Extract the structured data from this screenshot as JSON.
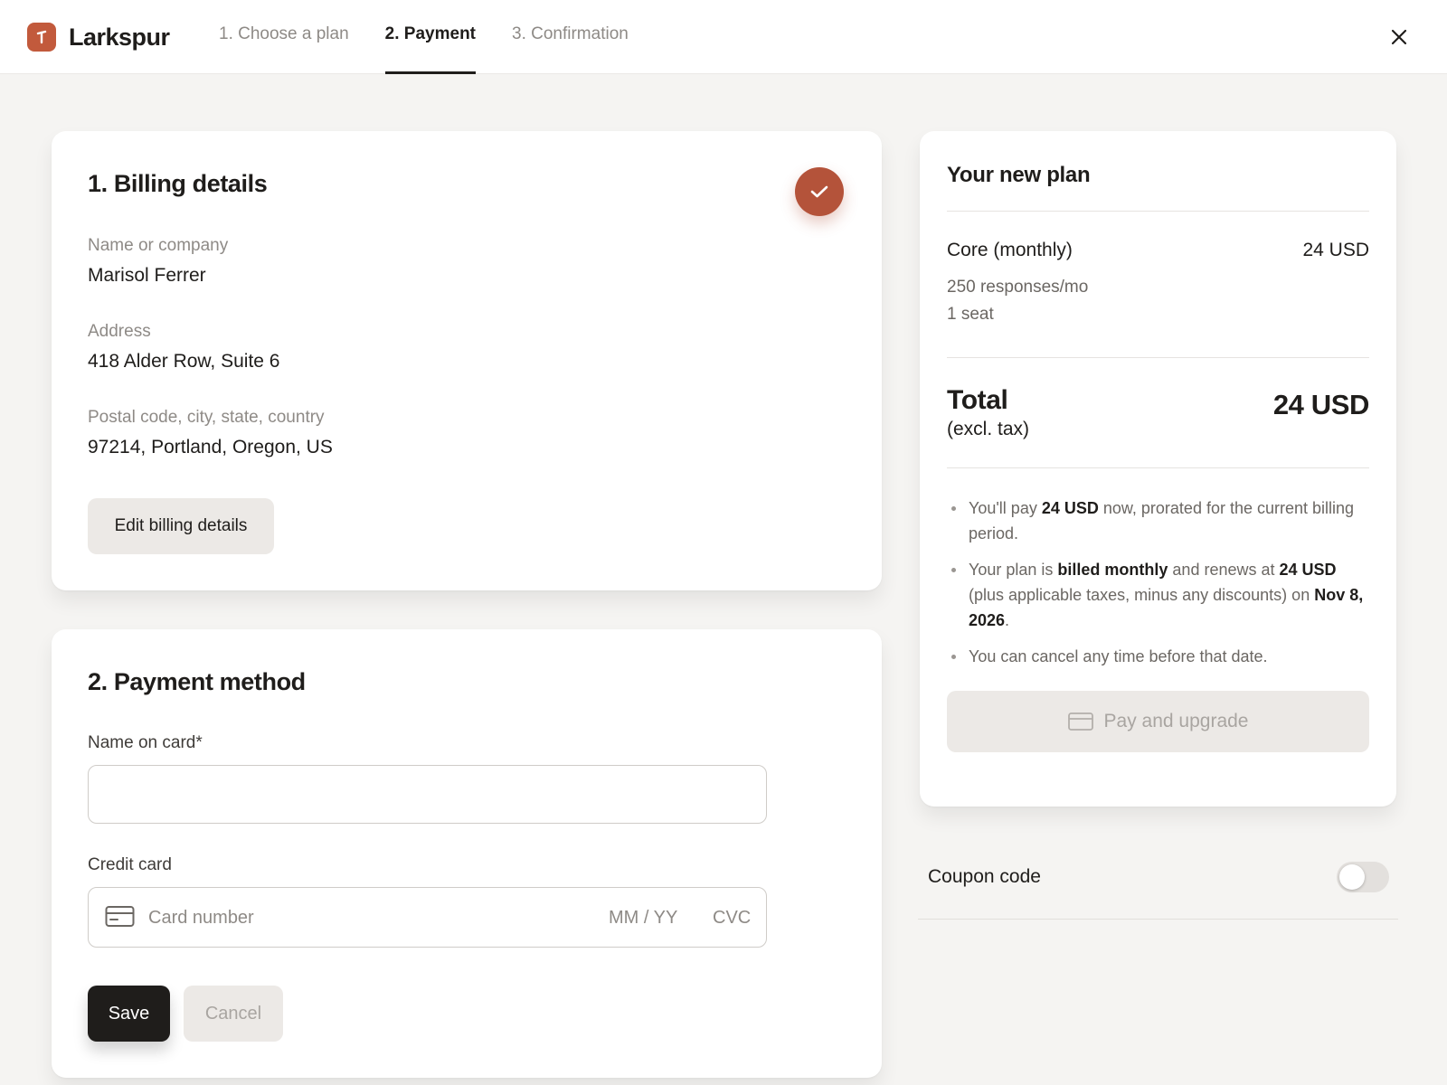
{
  "brand": {
    "name": "Larkspur",
    "accent_color": "#c25a3c"
  },
  "steps": [
    {
      "label": "1. Choose a plan",
      "active": false
    },
    {
      "label": "2. Payment",
      "active": true
    },
    {
      "label": "3. Confirmation",
      "active": false
    }
  ],
  "billing": {
    "title": "1. Billing details",
    "status_icon": "check-icon",
    "fields": [
      {
        "label": "Name or company",
        "value": "Marisol Ferrer"
      },
      {
        "label": "Address",
        "value": "418 Alder Row, Suite 6"
      },
      {
        "label": "Postal code, city, state, country",
        "value": "97214, Portland, Oregon, US"
      }
    ],
    "edit_button": "Edit billing details"
  },
  "payment": {
    "title": "2. Payment method",
    "name_label": "Name on card*",
    "name_value": "",
    "card_label": "Credit card",
    "card_number_placeholder": "Card number",
    "expiry_placeholder": "MM / YY",
    "cvc_placeholder": "CVC",
    "save_button": "Save",
    "cancel_button": "Cancel"
  },
  "summary": {
    "title": "Your new plan",
    "plan_name": "Core (monthly)",
    "plan_price": "24 USD",
    "features": [
      "250 responses/mo",
      "1 seat"
    ],
    "total_label": "Total",
    "total_sub": "(excl. tax)",
    "total_amount": "24 USD",
    "notes": [
      [
        "You'll pay ",
        "24 USD",
        " now, prorated for the current billing period."
      ],
      [
        "Your plan is ",
        "billed monthly",
        " and renews at ",
        "24 USD",
        " (plus applicable taxes, minus any discounts) on ",
        "Nov 8, 2026",
        "."
      ],
      [
        "You can cancel any time before that date."
      ]
    ],
    "pay_button": "Pay and upgrade"
  },
  "coupon": {
    "label": "Coupon code",
    "enabled": false
  }
}
